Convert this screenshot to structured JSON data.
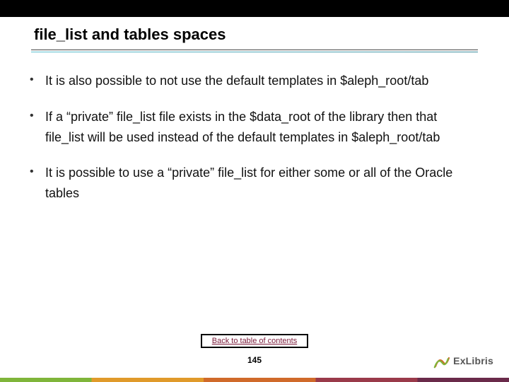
{
  "slide": {
    "title": "file_list and tables spaces",
    "bullets": [
      "It is also possible to not use the default templates in $aleph_root/tab",
      "If a “private” file_list file exists in the $data_root of the library then that file_list will be used instead of the default templates in $aleph_root/tab",
      "It is possible to use a “private” file_list for either some or all of the Oracle tables"
    ],
    "toc_link": "Back to table of contents",
    "page_number": "145",
    "logo_text": "ExLibris"
  }
}
